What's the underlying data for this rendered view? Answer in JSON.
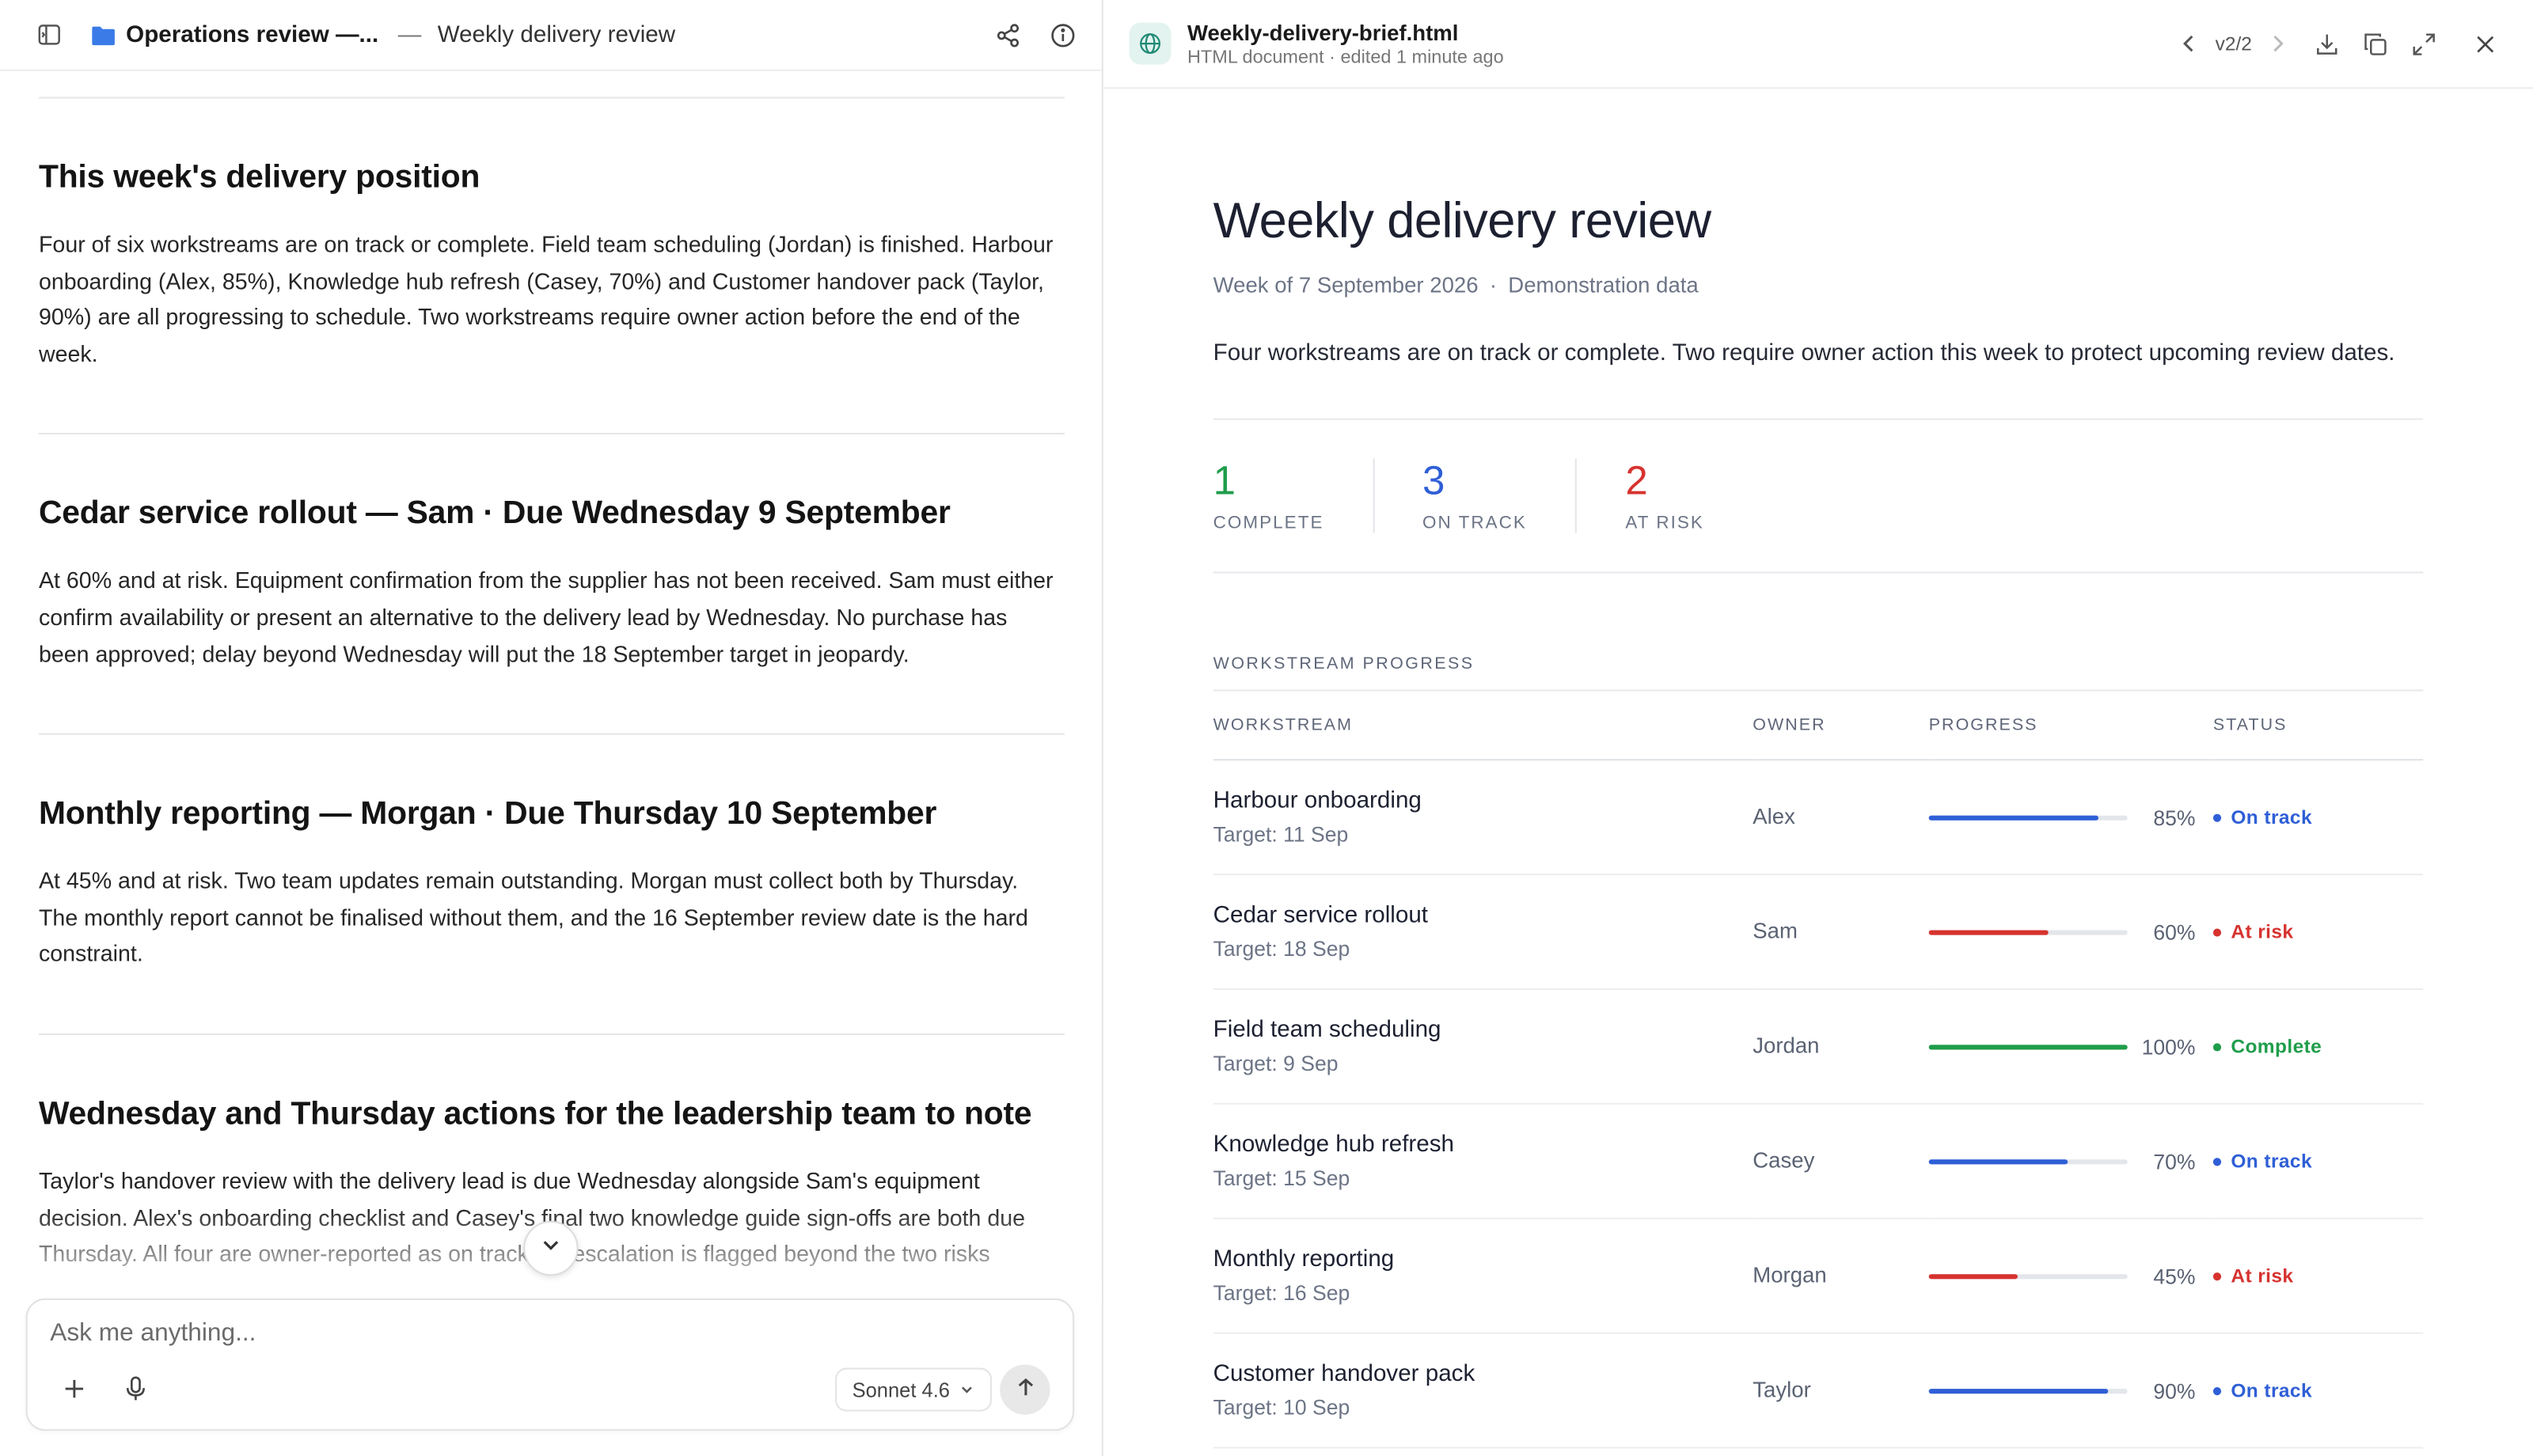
{
  "colors": {
    "green": "#1f9d4a",
    "blue": "#2f5fd6",
    "red": "#d6332f",
    "accent_teal": "#1f8a74"
  },
  "topbar": {
    "project": "Operations review —...",
    "separator": "—",
    "chat_title": "Weekly delivery review"
  },
  "chat": {
    "sections": [
      {
        "heading": "This week's delivery position",
        "body": "Four of six workstreams are on track or complete. Field team scheduling (Jordan) is finished. Harbour onboarding (Alex, 85%), Knowledge hub refresh (Casey, 70%) and Customer handover pack (Taylor, 90%) are all progressing to schedule. Two workstreams require owner action before the end of the week."
      },
      {
        "heading": "Cedar service rollout — Sam · Due Wednesday 9 September",
        "body": "At 60% and at risk. Equipment confirmation from the supplier has not been received. Sam must either confirm availability or present an alternative to the delivery lead by Wednesday. No purchase has been approved; delay beyond Wednesday will put the 18 September target in jeopardy."
      },
      {
        "heading": "Monthly reporting — Morgan · Due Thursday 10 September",
        "body": "At 45% and at risk. Two team updates remain outstanding. Morgan must collect both by Thursday. The monthly report cannot be finalised without them, and the 16 September review date is the hard constraint."
      },
      {
        "heading": "Wednesday and Thursday actions for the leadership team to note",
        "body": "Taylor's handover review with the delivery lead is due Wednesday alongside Sam's equipment decision. Alex's onboarding checklist and Casey's final two knowledge guide sign-offs are both due Thursday. All four are owner-reported as on track; no escalation is flagged beyond the two risks"
      }
    ]
  },
  "composer": {
    "placeholder": "Ask me anything...",
    "model": "Sonnet 4.6"
  },
  "artifact": {
    "file_name": "Weekly-delivery-brief.html",
    "file_type": "HTML document",
    "edited": "edited 1 minute ago",
    "version": "v2/2"
  },
  "doc": {
    "title": "Weekly delivery review",
    "week": "Week of 7 September 2026",
    "data_note": "Demonstration data",
    "summary": "Four workstreams are on track or complete. Two require owner action this week to protect upcoming review dates.",
    "kpis": [
      {
        "value": "1",
        "label": "COMPLETE",
        "color": "#1f9d4a"
      },
      {
        "value": "3",
        "label": "ON TRACK",
        "color": "#2f5fd6"
      },
      {
        "value": "2",
        "label": "AT RISK",
        "color": "#d6332f"
      }
    ],
    "progress_title": "WORKSTREAM PROGRESS",
    "columns": [
      "WORKSTREAM",
      "OWNER",
      "PROGRESS",
      "STATUS"
    ],
    "rows": [
      {
        "name": "Harbour onboarding",
        "target": "Target: 11 Sep",
        "owner": "Alex",
        "progress": 0.85,
        "pct": "85%",
        "status": "On track",
        "status_color": "#2f5fd6"
      },
      {
        "name": "Cedar service rollout",
        "target": "Target: 18 Sep",
        "owner": "Sam",
        "progress": 0.6,
        "pct": "60%",
        "status": "At risk",
        "status_color": "#d6332f"
      },
      {
        "name": "Field team scheduling",
        "target": "Target: 9 Sep",
        "owner": "Jordan",
        "progress": 1.0,
        "pct": "100%",
        "status": "Complete",
        "status_color": "#1f9d4a"
      },
      {
        "name": "Knowledge hub refresh",
        "target": "Target: 15 Sep",
        "owner": "Casey",
        "progress": 0.7,
        "pct": "70%",
        "status": "On track",
        "status_color": "#2f5fd6"
      },
      {
        "name": "Monthly reporting",
        "target": "Target: 16 Sep",
        "owner": "Morgan",
        "progress": 0.45,
        "pct": "45%",
        "status": "At risk",
        "status_color": "#d6332f"
      },
      {
        "name": "Customer handover pack",
        "target": "Target: 10 Sep",
        "owner": "Taylor",
        "progress": 0.9,
        "pct": "90%",
        "status": "On track",
        "status_color": "#2f5fd6"
      }
    ]
  }
}
